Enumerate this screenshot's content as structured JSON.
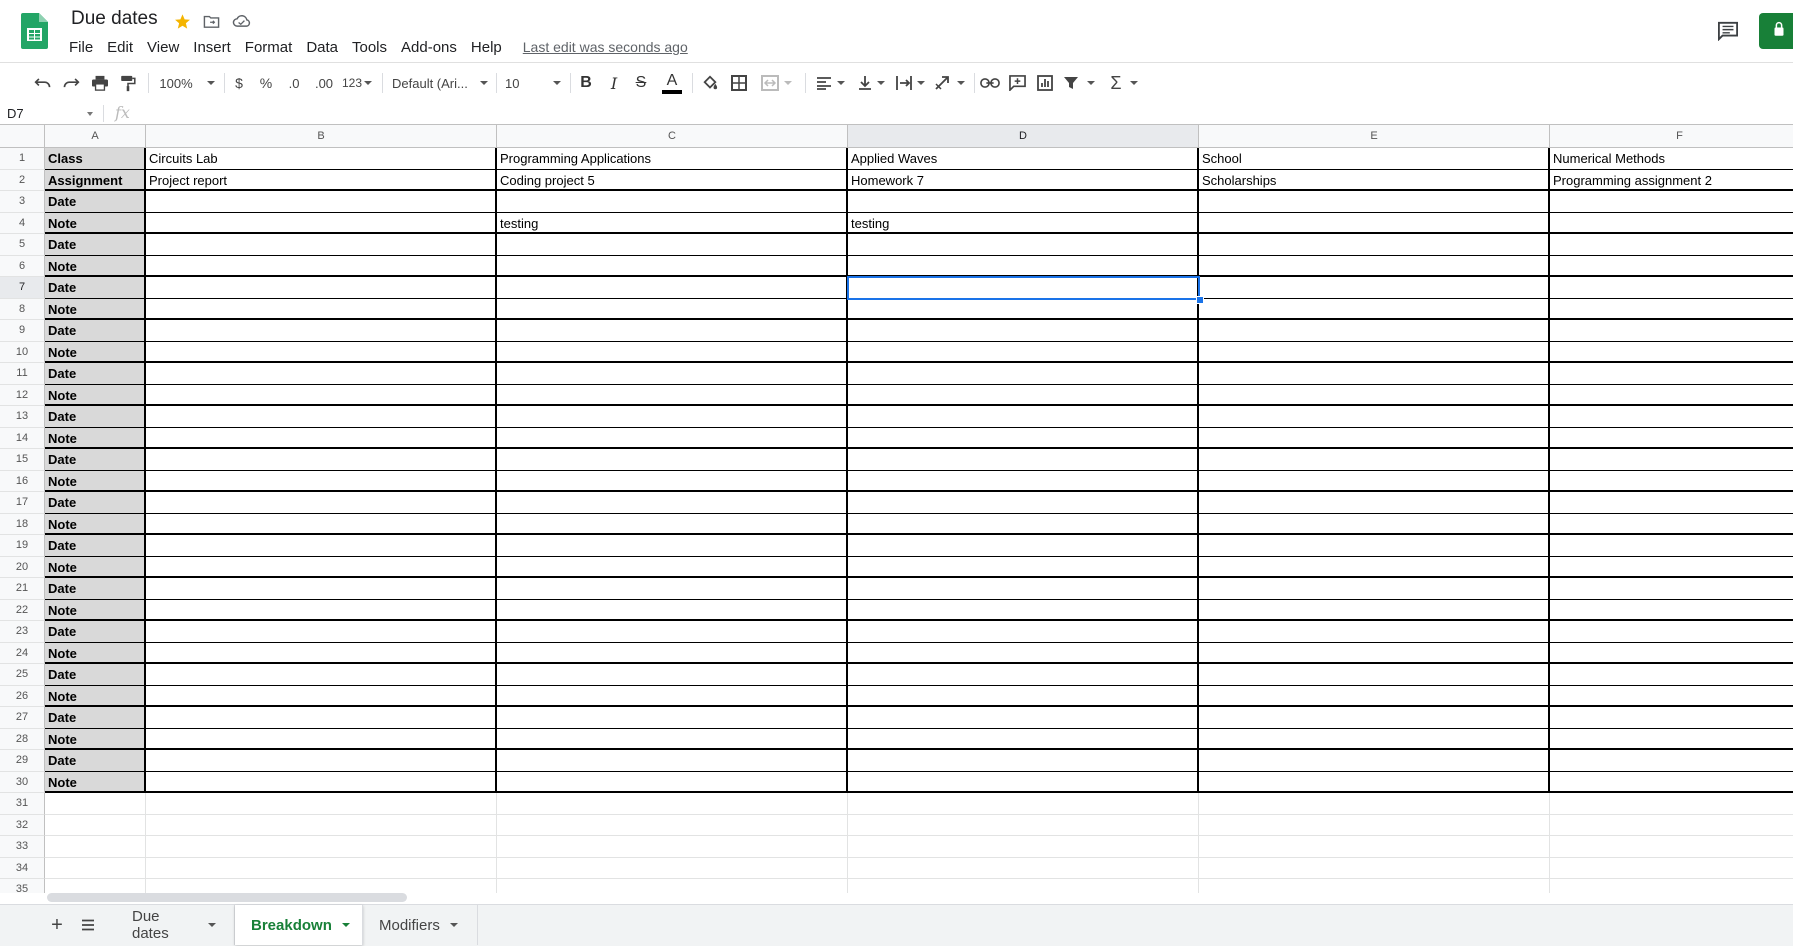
{
  "header": {
    "title": "Due dates",
    "menu": [
      "File",
      "Edit",
      "View",
      "Insert",
      "Format",
      "Data",
      "Tools",
      "Add-ons",
      "Help"
    ],
    "last_edit": "Last edit was seconds ago"
  },
  "toolbar": {
    "zoom": "100%",
    "currency": "$",
    "percent": "%",
    "decimal_decrease": ".0",
    "decimal_increase": ".00",
    "more_formats": "123",
    "font": "Default (Ari...",
    "font_size": "10",
    "bold": "B",
    "italic": "I",
    "strike": "S",
    "text_color": "A",
    "functions": "Σ"
  },
  "formula_bar": {
    "name_box": "D7",
    "fx": "fx",
    "value": ""
  },
  "grid": {
    "columns": [
      "A",
      "B",
      "C",
      "D",
      "E",
      "F"
    ],
    "selected_column": "D",
    "selected_row": 7,
    "row_numbers": [
      "1",
      "2",
      "3",
      "4",
      "5",
      "6",
      "7",
      "8",
      "9",
      "10",
      "11",
      "12",
      "13",
      "14",
      "15",
      "16",
      "17",
      "18",
      "19",
      "20",
      "21",
      "22",
      "23",
      "24",
      "25",
      "26",
      "27",
      "28",
      "29",
      "30",
      "31",
      "32",
      "33",
      "34",
      "35"
    ],
    "rows": [
      [
        "Class",
        "Circuits Lab",
        "Programming Applications",
        "Applied Waves",
        "School",
        "Numerical Methods"
      ],
      [
        "Assignment",
        "Project report",
        "Coding project 5",
        "Homework 7",
        "Scholarships",
        "Programming assignment 2"
      ],
      [
        "Date",
        "",
        "",
        "",
        "",
        ""
      ],
      [
        "Note",
        "",
        "testing",
        "testing",
        "",
        ""
      ],
      [
        "Date",
        "",
        "",
        "",
        "",
        ""
      ],
      [
        "Note",
        "",
        "",
        "",
        "",
        ""
      ],
      [
        "Date",
        "",
        "",
        "",
        "",
        ""
      ],
      [
        "Note",
        "",
        "",
        "",
        "",
        ""
      ],
      [
        "Date",
        "",
        "",
        "",
        "",
        ""
      ],
      [
        "Note",
        "",
        "",
        "",
        "",
        ""
      ],
      [
        "Date",
        "",
        "",
        "",
        "",
        ""
      ],
      [
        "Note",
        "",
        "",
        "",
        "",
        ""
      ],
      [
        "Date",
        "",
        "",
        "",
        "",
        ""
      ],
      [
        "Note",
        "",
        "",
        "",
        "",
        ""
      ],
      [
        "Date",
        "",
        "",
        "",
        "",
        ""
      ],
      [
        "Note",
        "",
        "",
        "",
        "",
        ""
      ],
      [
        "Date",
        "",
        "",
        "",
        "",
        ""
      ],
      [
        "Note",
        "",
        "",
        "",
        "",
        ""
      ],
      [
        "Date",
        "",
        "",
        "",
        "",
        ""
      ],
      [
        "Note",
        "",
        "",
        "",
        "",
        ""
      ],
      [
        "Date",
        "",
        "",
        "",
        "",
        ""
      ],
      [
        "Note",
        "",
        "",
        "",
        "",
        ""
      ],
      [
        "Date",
        "",
        "",
        "",
        "",
        ""
      ],
      [
        "Note",
        "",
        "",
        "",
        "",
        ""
      ],
      [
        "Date",
        "",
        "",
        "",
        "",
        ""
      ],
      [
        "Note",
        "",
        "",
        "",
        "",
        ""
      ],
      [
        "Date",
        "",
        "",
        "",
        "",
        ""
      ],
      [
        "Note",
        "",
        "",
        "",
        "",
        ""
      ],
      [
        "Date",
        "",
        "",
        "",
        "",
        ""
      ],
      [
        "Note",
        "",
        "",
        "",
        "",
        ""
      ]
    ]
  },
  "sheets": {
    "tabs": [
      "Due dates",
      "Breakdown",
      "Modifiers"
    ],
    "active": "Breakdown"
  },
  "colors": {
    "brand_green": "#188038",
    "selection_blue": "#1a73e8",
    "header_cell_gray": "#d9d9d9",
    "star_yellow": "#f4b400"
  },
  "icons": [
    "sheets-logo-icon",
    "star-icon",
    "move-to-folder-icon",
    "cloud-status-icon",
    "comments-icon",
    "share-icon"
  ]
}
